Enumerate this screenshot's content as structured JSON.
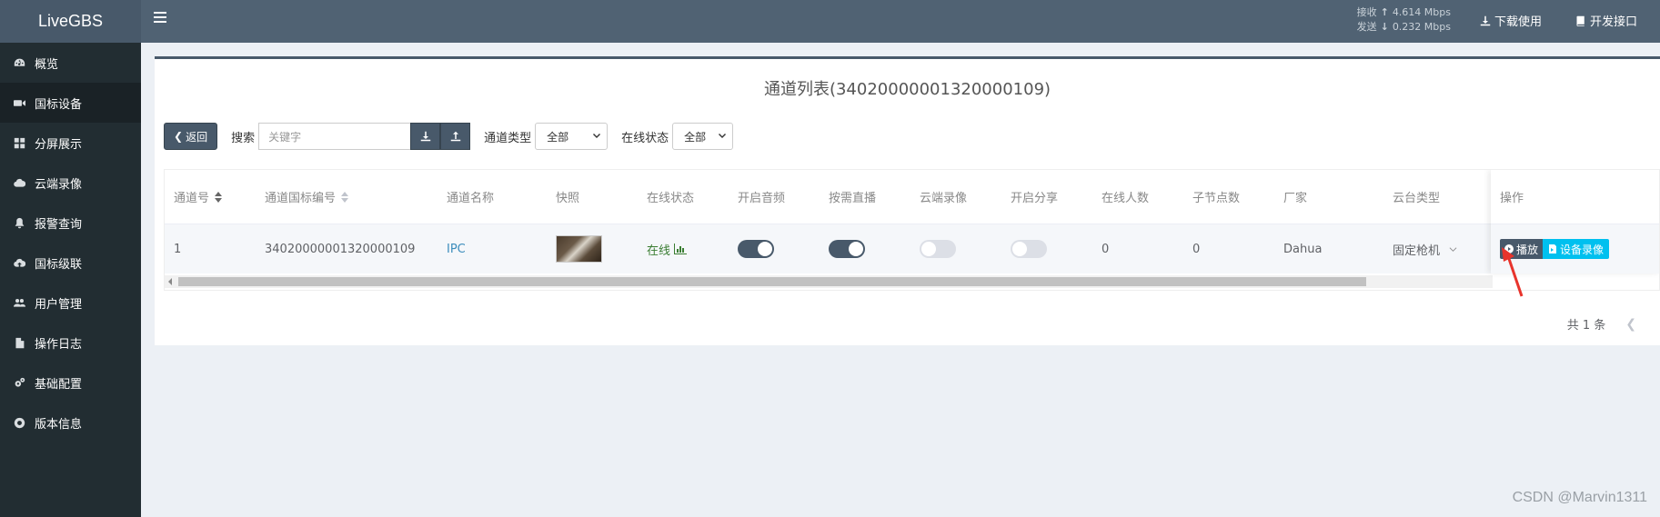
{
  "app": {
    "title": "LiveGBS"
  },
  "sidebar": {
    "items": [
      {
        "label": "概览",
        "icon": "dashboard-icon",
        "active": false
      },
      {
        "label": "国标设备",
        "icon": "video-camera-icon",
        "active": true
      },
      {
        "label": "分屏展示",
        "icon": "grid-icon",
        "active": false
      },
      {
        "label": "云端录像",
        "icon": "cloud-icon",
        "active": false
      },
      {
        "label": "报警查询",
        "icon": "bell-icon",
        "active": false
      },
      {
        "label": "国标级联",
        "icon": "cloud-upload-icon",
        "active": false
      },
      {
        "label": "用户管理",
        "icon": "users-icon",
        "active": false
      },
      {
        "label": "操作日志",
        "icon": "file-icon",
        "active": false
      },
      {
        "label": "基础配置",
        "icon": "cogs-icon",
        "active": false
      },
      {
        "label": "版本信息",
        "icon": "lifebuoy-icon",
        "active": false
      }
    ]
  },
  "header": {
    "recv_label": "接收",
    "recv_value": "4.614 Mbps",
    "send_label": "发送",
    "send_value": "0.232 Mbps",
    "download_label": "下载使用",
    "api_label": "开发接口"
  },
  "page": {
    "title": "通道列表(34020000001320000109)"
  },
  "toolbar": {
    "back_label": "返回",
    "search_label": "搜索",
    "search_placeholder": "关键字",
    "channel_type_label": "通道类型",
    "channel_type_value": "全部",
    "online_status_label": "在线状态",
    "online_status_value": "全部"
  },
  "table": {
    "columns": [
      "通道号",
      "通道国标编号",
      "通道名称",
      "快照",
      "在线状态",
      "开启音频",
      "按需直播",
      "云端录像",
      "开启分享",
      "在线人数",
      "子节点数",
      "厂家",
      "云台类型",
      "操作"
    ],
    "rows": [
      {
        "channel_no": "1",
        "gb_id": "34020000001320000109",
        "name": "IPC",
        "status": "在线",
        "audio_on": true,
        "ondemand_on": true,
        "cloud_record_on": false,
        "share_on": false,
        "online_count": "0",
        "child_count": "0",
        "manufacturer": "Dahua",
        "ptz_type": "固定枪机",
        "play_label": "播放",
        "record_label": "设备录像"
      }
    ]
  },
  "pagination": {
    "total_label": "共 1 条"
  },
  "watermark": "CSDN @Marvin1311",
  "colors": {
    "primary": "#48596a",
    "sidebar": "#222d32",
    "info": "#00c0ef",
    "online": "#3a7d32",
    "annotation": "#e8342c"
  }
}
